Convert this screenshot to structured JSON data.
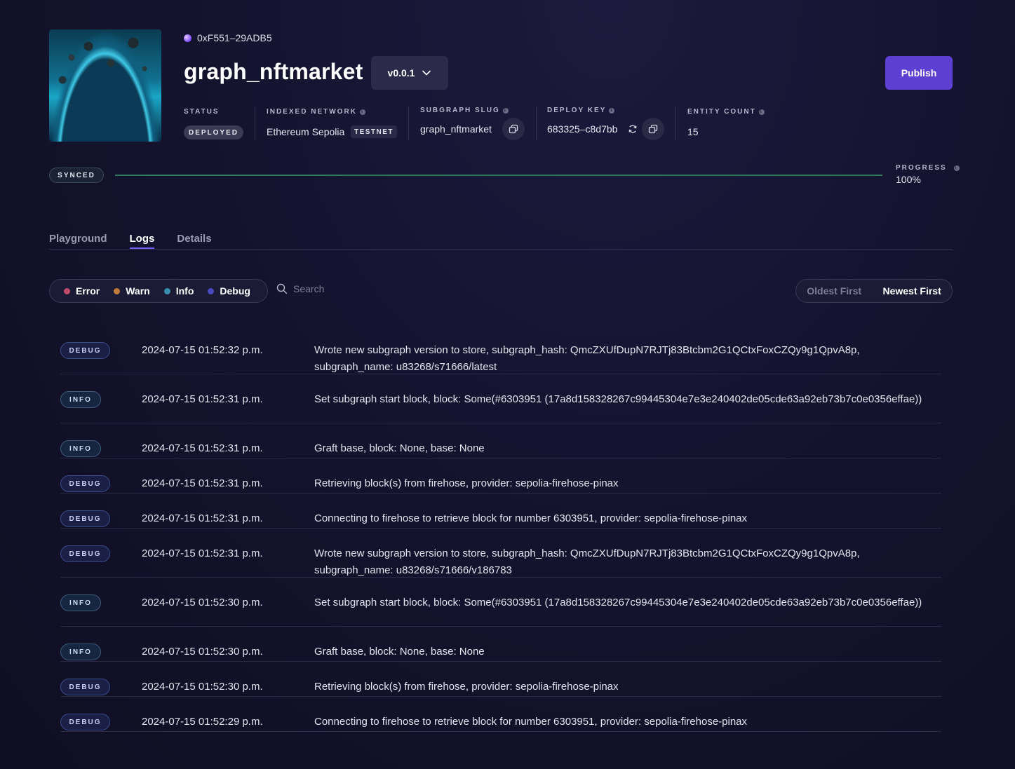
{
  "header": {
    "address": "0xF551–29ADB5",
    "title": "graph_nftmarket",
    "version": "v0.0.1",
    "publish_label": "Publish"
  },
  "meta": {
    "status_label": "STATUS",
    "status_value": "DEPLOYED",
    "network_label": "INDEXED NETWORK",
    "network_value": "Ethereum Sepolia",
    "network_tag": "TESTNET",
    "slug_label": "SUBGRAPH SLUG",
    "slug_value": "graph_nftmarket",
    "deploy_key_label": "DEPLOY KEY",
    "deploy_key_value": "683325–c8d7bb",
    "entity_count_label": "ENTITY COUNT",
    "entity_count_value": "15"
  },
  "sync": {
    "status": "SYNCED",
    "progress_label": "PROGRESS",
    "progress_value": "100%",
    "progress_fraction": 1.0
  },
  "tabs": [
    {
      "label": "Playground",
      "active": false
    },
    {
      "label": "Logs",
      "active": true
    },
    {
      "label": "Details",
      "active": false
    }
  ],
  "filters": [
    {
      "label": "Error",
      "color": "#c04a6a"
    },
    {
      "label": "Warn",
      "color": "#c07a3a"
    },
    {
      "label": "Info",
      "color": "#3a8fb0"
    },
    {
      "label": "Debug",
      "color": "#4a4ac0"
    }
  ],
  "search": {
    "placeholder": "Search"
  },
  "sort": {
    "oldest": "Oldest First",
    "newest": "Newest First"
  },
  "logs": [
    {
      "level": "DEBUG",
      "timestamp": "2024-07-15 01:52:32 p.m.",
      "message": "Wrote new subgraph version to store, subgraph_hash: QmcZXUfDupN7RJTj83Btcbm2G1QCtxFoxCZQy9g1QpvA8p, subgraph_name: u83268/s71666/latest"
    },
    {
      "level": "INFO",
      "timestamp": "2024-07-15 01:52:31 p.m.",
      "message": "Set subgraph start block, block: Some(#6303951 (17a8d158328267c99445304e7e3e240402de05cde63a92eb73b7c0e0356effae))"
    },
    {
      "level": "INFO",
      "timestamp": "2024-07-15 01:52:31 p.m.",
      "message": "Graft base, block: None, base: None"
    },
    {
      "level": "DEBUG",
      "timestamp": "2024-07-15 01:52:31 p.m.",
      "message": "Retrieving block(s) from firehose, provider: sepolia-firehose-pinax"
    },
    {
      "level": "DEBUG",
      "timestamp": "2024-07-15 01:52:31 p.m.",
      "message": "Connecting to firehose to retrieve block for number 6303951, provider: sepolia-firehose-pinax"
    },
    {
      "level": "DEBUG",
      "timestamp": "2024-07-15 01:52:31 p.m.",
      "message": "Wrote new subgraph version to store, subgraph_hash: QmcZXUfDupN7RJTj83Btcbm2G1QCtxFoxCZQy9g1QpvA8p, subgraph_name: u83268/s71666/v186783"
    },
    {
      "level": "INFO",
      "timestamp": "2024-07-15 01:52:30 p.m.",
      "message": "Set subgraph start block, block: Some(#6303951 (17a8d158328267c99445304e7e3e240402de05cde63a92eb73b7c0e0356effae))"
    },
    {
      "level": "INFO",
      "timestamp": "2024-07-15 01:52:30 p.m.",
      "message": "Graft base, block: None, base: None"
    },
    {
      "level": "DEBUG",
      "timestamp": "2024-07-15 01:52:30 p.m.",
      "message": "Retrieving block(s) from firehose, provider: sepolia-firehose-pinax"
    },
    {
      "level": "DEBUG",
      "timestamp": "2024-07-15 01:52:29 p.m.",
      "message": "Connecting to firehose to retrieve block for number 6303951, provider: sepolia-firehose-pinax"
    }
  ]
}
